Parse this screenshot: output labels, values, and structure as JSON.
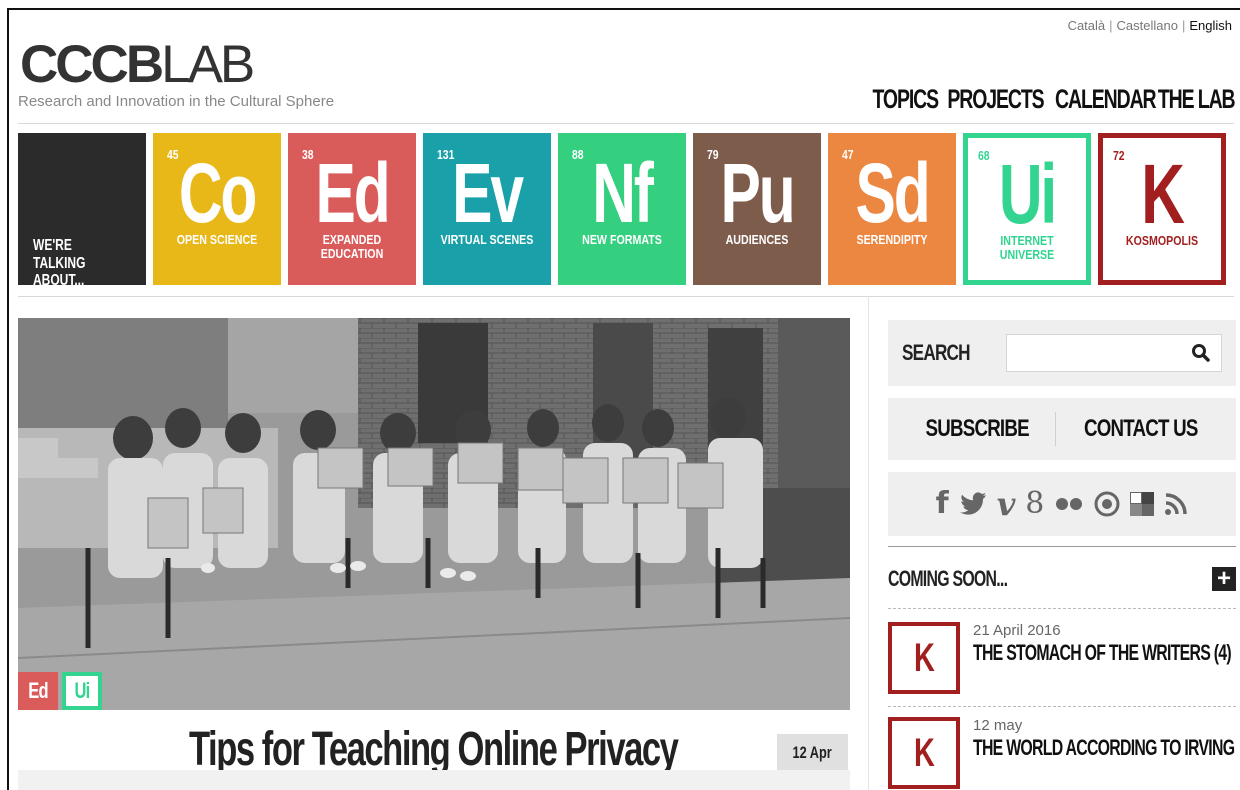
{
  "languages": {
    "items": [
      "Català",
      "Castellano",
      "English"
    ],
    "active": "English",
    "separator": "|"
  },
  "logo": {
    "bold": "CCCB",
    "light": "LAB"
  },
  "tagline": "Research and Innovation in the Cultural Sphere",
  "nav": {
    "items": [
      "TOPICS",
      "PROJECTS",
      "CALENDAR",
      "THE LAB"
    ]
  },
  "tiles": {
    "intro": "WE'RE TALKING ABOUT...",
    "items": [
      {
        "num": "45",
        "sym": "Co",
        "label": "OPEN SCIENCE",
        "color": "#e8b718",
        "style": "filled"
      },
      {
        "num": "38",
        "sym": "Ed",
        "label": "EXPANDED EDUCATION",
        "color": "#d95c5b",
        "style": "filled"
      },
      {
        "num": "131",
        "sym": "Ev",
        "label": "VIRTUAL SCENES",
        "color": "#1aa0a8",
        "style": "filled"
      },
      {
        "num": "88",
        "sym": "Nf",
        "label": "NEW FORMATS",
        "color": "#34cf7f",
        "style": "filled"
      },
      {
        "num": "79",
        "sym": "Pu",
        "label": "AUDIENCES",
        "color": "#7e5c4c",
        "style": "filled"
      },
      {
        "num": "47",
        "sym": "Sd",
        "label": "SERENDIPITY",
        "color": "#ec8741",
        "style": "filled"
      },
      {
        "num": "68",
        "sym": "Ui",
        "label": "INTERNET UNIVERSE",
        "color": "#33d490",
        "style": "outline"
      },
      {
        "num": "72",
        "sym": "K",
        "label": "KOSMOPOLIS",
        "color": "#a21f1f",
        "style": "outline"
      }
    ]
  },
  "hero": {
    "tags": [
      "Ed",
      "Ui"
    ],
    "title": "Tips for Teaching Online Privacy",
    "date": "12 Apr"
  },
  "sidebar": {
    "search_label": "SEARCH",
    "search_placeholder": "",
    "subscribe": "SUBSCRIBE",
    "contact": "CONTACT US",
    "social_icons": [
      "facebook-icon",
      "twitter-icon",
      "vimeo-icon",
      "googleplus-icon",
      "flickr-icon",
      "instagram-icon",
      "delicious-icon",
      "rss-icon"
    ],
    "coming_soon": "COMING SOON...",
    "events": [
      {
        "badge": "K",
        "date": "21 April 2016",
        "title": "THE STOMACH OF THE WRITERS (4)"
      },
      {
        "badge": "K",
        "date": "12 may",
        "title": "THE WORLD ACCORDING TO IRVING"
      }
    ]
  }
}
